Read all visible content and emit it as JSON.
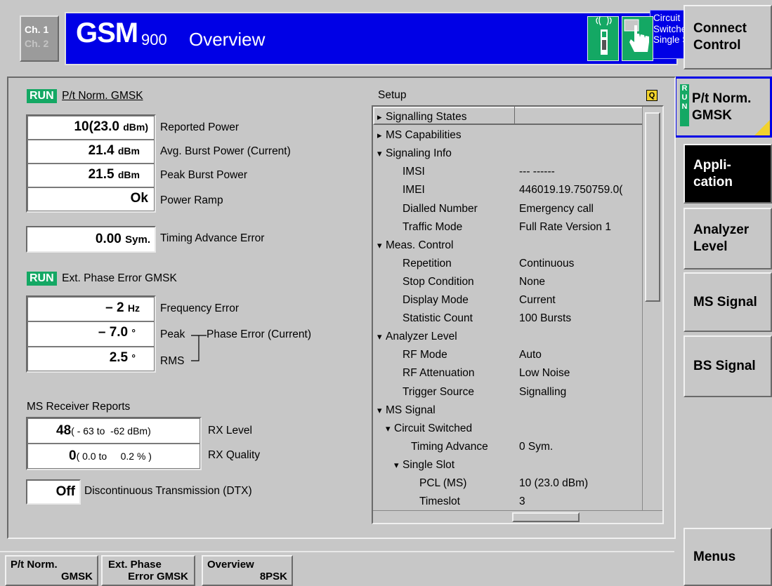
{
  "header": {
    "ch1": "Ch. 1",
    "ch2": "Ch. 2",
    "gsm": "GSM",
    "band": "900",
    "title": "Overview",
    "mode_lines": "Circuit\nSwitched\nSingle Slot",
    "icons": [
      "mobile-phone-signal-icon",
      "hand-pointer-icon"
    ],
    "accent": "#0000e6",
    "run_green": "#14a864"
  },
  "softkeys": {
    "connect_control": "Connect\nControl",
    "pt_norm": "P/t Norm.\nGMSK",
    "run_vertical": "R\nU\nN",
    "application": "Appli-\ncation",
    "analyzer_level": "Analyzer\nLevel",
    "ms_signal": "MS Signal",
    "bs_signal": "BS Signal",
    "menus": "Menus"
  },
  "pt_section": {
    "run": "RUN",
    "title": "P/t Norm. GMSK",
    "rows": [
      {
        "value": "10(23.0",
        "unit": "dBm)",
        "label": "Reported Power"
      },
      {
        "value": "21.4",
        "unit": "dBm",
        "label": "Avg. Burst Power (Current)"
      },
      {
        "value": "21.5",
        "unit": "dBm",
        "label": "Peak Burst Power"
      },
      {
        "value": "Ok",
        "unit": "",
        "label": "Power Ramp"
      }
    ],
    "timing": {
      "value": "0.00",
      "unit": "Sym.",
      "label": "Timing Advance Error"
    }
  },
  "phase_section": {
    "run": "RUN",
    "title": "Ext. Phase Error GMSK",
    "freq": {
      "value": "– 2",
      "unit": "Hz",
      "label": "Frequency Error"
    },
    "peak": {
      "value": "– 7.0",
      "unit": "°",
      "label": "Peak"
    },
    "rms": {
      "value": "2.5",
      "unit": "°",
      "label": "RMS"
    },
    "group_label": "Phase Error (Current)"
  },
  "receiver": {
    "title": "MS Receiver Reports",
    "rx_level": {
      "value": "48",
      "range": "( - 63 to  -62 dBm)",
      "label": "RX Level"
    },
    "rx_quality": {
      "value": "0",
      "range": "( 0.0 to     0.2 % )",
      "label": "RX Quality"
    },
    "dtx": {
      "value": "Off",
      "label": "Discontinuous Transmission (DTX)"
    }
  },
  "setup": {
    "title": "Setup",
    "rows": [
      {
        "text": "Signalling States",
        "value": "",
        "arrow": "right",
        "indent": 0
      },
      {
        "text": "MS Capabilities",
        "value": "",
        "arrow": "right",
        "indent": 0
      },
      {
        "text": "Signaling Info",
        "value": "",
        "arrow": "down",
        "indent": 0
      },
      {
        "text": "IMSI",
        "value": "---  ------",
        "arrow": "",
        "indent": 1
      },
      {
        "text": "IMEI",
        "value": "446019.19.750759.0(",
        "arrow": "",
        "indent": 1
      },
      {
        "text": "Dialled Number",
        "value": "Emergency call",
        "arrow": "",
        "indent": 1
      },
      {
        "text": "Traffic Mode",
        "value": "Full Rate Version 1",
        "arrow": "",
        "indent": 1
      },
      {
        "text": "Meas. Control",
        "value": "",
        "arrow": "down",
        "indent": 0
      },
      {
        "text": "Repetition",
        "value": "Continuous",
        "arrow": "",
        "indent": 1
      },
      {
        "text": "Stop Condition",
        "value": "None",
        "arrow": "",
        "indent": 1
      },
      {
        "text": "Display Mode",
        "value": "Current",
        "arrow": "",
        "indent": 1
      },
      {
        "text": "Statistic Count",
        "value": "100 Bursts",
        "arrow": "",
        "indent": 1
      },
      {
        "text": "Analyzer Level",
        "value": "",
        "arrow": "down",
        "indent": 0
      },
      {
        "text": "RF Mode",
        "value": "Auto",
        "arrow": "",
        "indent": 1
      },
      {
        "text": "RF Attenuation",
        "value": "Low Noise",
        "arrow": "",
        "indent": 1
      },
      {
        "text": "Trigger Source",
        "value": "Signalling",
        "arrow": "",
        "indent": 1
      },
      {
        "text": "MS Signal",
        "value": "",
        "arrow": "down",
        "indent": 0
      },
      {
        "text": "Circuit Switched",
        "value": "",
        "arrow": "down",
        "indent": 1
      },
      {
        "text": "Timing Advance",
        "value": "0  Sym.",
        "arrow": "",
        "indent": 2
      },
      {
        "text": "Single Slot",
        "value": "",
        "arrow": "down",
        "indent": 2
      },
      {
        "text": "PCL (MS)",
        "value": "10  (23.0 dBm)",
        "arrow": "",
        "indent": 3
      },
      {
        "text": "Timeslot",
        "value": "3",
        "arrow": "",
        "indent": 3
      }
    ]
  },
  "bottom_tabs": [
    {
      "line1": "P/t Norm.",
      "line2": "GMSK"
    },
    {
      "line1": "Ext. Phase",
      "line2": "Error GMSK"
    },
    {
      "line1": "Overview",
      "line2": "8PSK"
    }
  ]
}
